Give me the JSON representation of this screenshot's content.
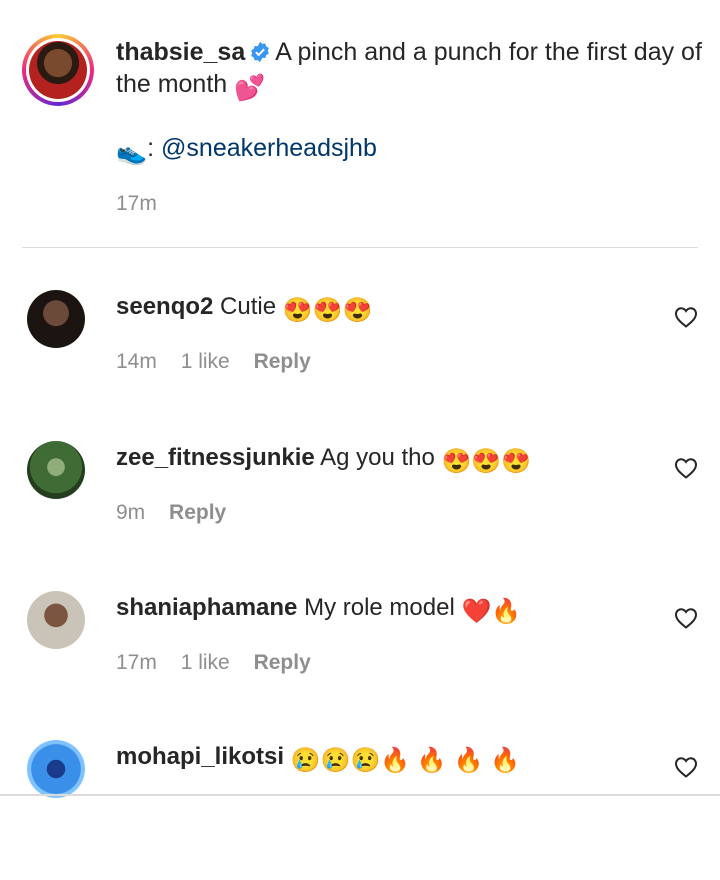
{
  "caption": {
    "username": "thabsie_sa",
    "text": "A pinch and a punch for the first day of the month",
    "emoji_end": "💕",
    "shoe_emoji": "👟",
    "shoe_sep": ":",
    "mention": "@sneakerheadsjhb",
    "time": "17m"
  },
  "comments": [
    {
      "username": "seenqo2",
      "text": "Cutie",
      "emojis": "😍😍😍",
      "time": "14m",
      "likes": "1 like",
      "reply": "Reply"
    },
    {
      "username": "zee_fitnessjunkie",
      "text": "Ag you tho",
      "emojis": "😍😍😍",
      "time": "9m",
      "likes": "",
      "reply": "Reply"
    },
    {
      "username": "shaniaphamane",
      "text": "My role model",
      "emojis": "❤️🔥",
      "time": "17m",
      "likes": "1 like",
      "reply": "Reply"
    },
    {
      "username": "mohapi_likotsi",
      "text": "",
      "emojis": "😢😢😢🔥 🔥 🔥 🔥",
      "time": "",
      "likes": "",
      "reply": ""
    }
  ],
  "colors": {
    "verified": "#3897f0",
    "mention": "#00376b",
    "meta": "#8e8e8e"
  }
}
